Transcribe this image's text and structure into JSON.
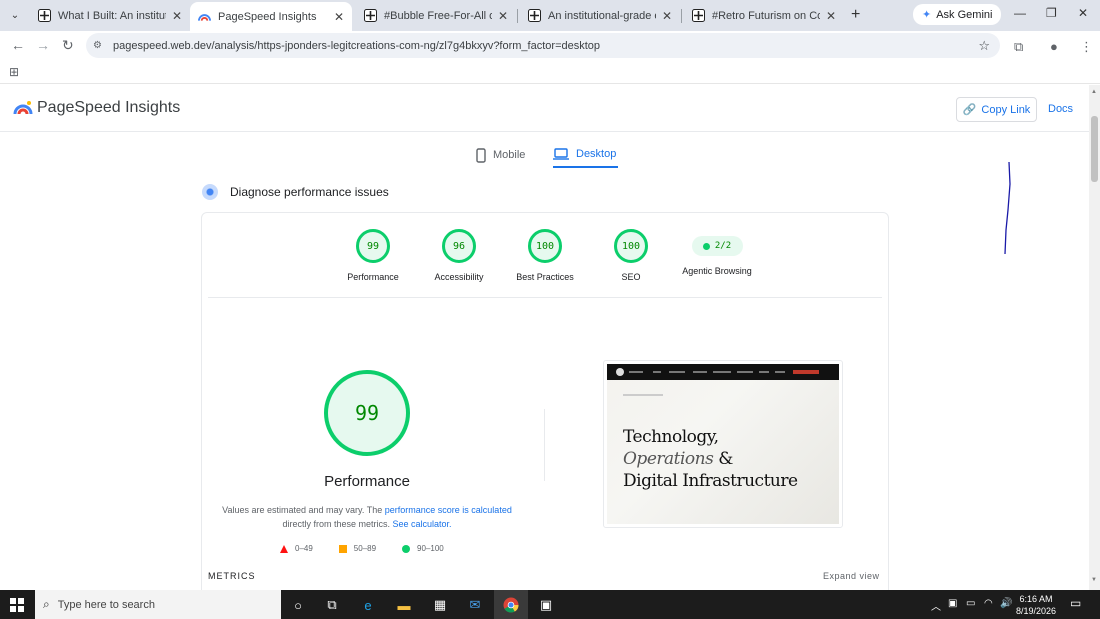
{
  "browser": {
    "tabs": [
      {
        "title": "What I Built: An institutional-g",
        "active": false
      },
      {
        "title": "PageSpeed Insights",
        "active": true
      },
      {
        "title": "#Bubble Free-For-All on Contr",
        "active": false
      },
      {
        "title": "An institutional-grade executi",
        "active": false
      },
      {
        "title": "#Retro Futurism on Contra",
        "active": false
      }
    ],
    "new_tab_icon": "plus-icon",
    "gemini_label": "Ask Gemini",
    "url": "pagespeed.web.dev/analysis/https-jponders-legitcreations-com-ng/zl7g4bkxyv?form_factor=desktop"
  },
  "header": {
    "title": "PageSpeed Insights",
    "copy_link": "Copy Link",
    "docs": "Docs"
  },
  "device_tabs": {
    "mobile": "Mobile",
    "desktop": "Desktop",
    "active": "desktop"
  },
  "diagnose": {
    "title": "Diagnose performance issues"
  },
  "scores": [
    {
      "label": "Performance",
      "value": "99"
    },
    {
      "label": "Accessibility",
      "value": "96"
    },
    {
      "label": "Best Practices",
      "value": "100"
    },
    {
      "label": "SEO",
      "value": "100"
    }
  ],
  "agentic": {
    "label": "Agentic Browsing",
    "value": "2/2"
  },
  "main_score": {
    "value": "99",
    "label": "Performance"
  },
  "estimate": {
    "text1": "Values are estimated and may vary. The",
    "link1": "performance score is calculated",
    "text2": "directly from these metrics.",
    "link2": "See calculator."
  },
  "legend": [
    {
      "range": "0–49"
    },
    {
      "range": "50–89"
    },
    {
      "range": "90–100"
    }
  ],
  "screenshot": {
    "line1": "Technology,",
    "line2_italic": "Operations",
    "line2_rest": "&",
    "line3": "Digital Infrastructure"
  },
  "metrics": {
    "title": "METRICS",
    "expand": "Expand view"
  },
  "taskbar": {
    "search_placeholder": "Type here to search",
    "time": "6:16 AM",
    "date": "8/19/2026"
  },
  "colors": {
    "pass_green": "#0cce6b",
    "pass_text": "#008800",
    "link_blue": "#1a73e8",
    "fail_red": "#ff1212",
    "average_orange": "#ffa400"
  }
}
